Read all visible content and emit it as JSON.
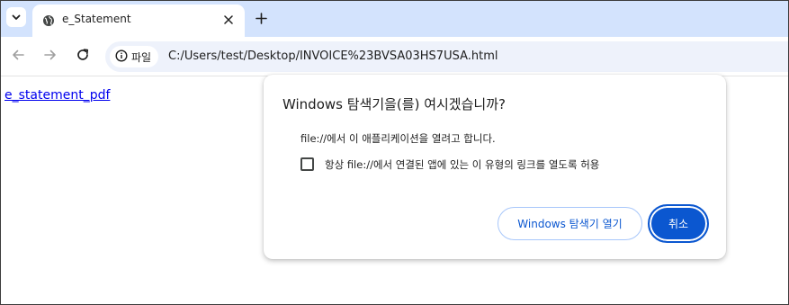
{
  "browser": {
    "tab": {
      "title": "e_Statement"
    },
    "address": {
      "chip_label": "파일",
      "url": "C:/Users/test/Desktop/INVOICE%23BVSA03HS7USA.html"
    },
    "icons": {
      "tab_search": "chevron-down-icon",
      "favicon": "globe-icon",
      "tab_close": "close-icon",
      "new_tab": "plus-icon",
      "back": "arrow-left-icon",
      "forward": "arrow-right-icon",
      "reload": "reload-icon",
      "site_info": "info-icon"
    }
  },
  "page": {
    "link_text": "e_statement_pdf"
  },
  "dialog": {
    "title": "Windows 탐색기을(를) 여시겠습니까?",
    "message": "file://에서 이 애플리케이션을 열려고 합니다.",
    "checkbox_label": "항상 file://에서 연결된 앱에 있는 이 유형의 링크를 열도록 허용",
    "checkbox_checked": false,
    "open_button": "Windows 탐색기 열기",
    "cancel_button": "취소"
  },
  "colors": {
    "tabstrip_bg": "#d3e3fd",
    "omnibox_bg": "#eef2fb",
    "accent": "#0b57d0",
    "link": "#0000ee"
  }
}
